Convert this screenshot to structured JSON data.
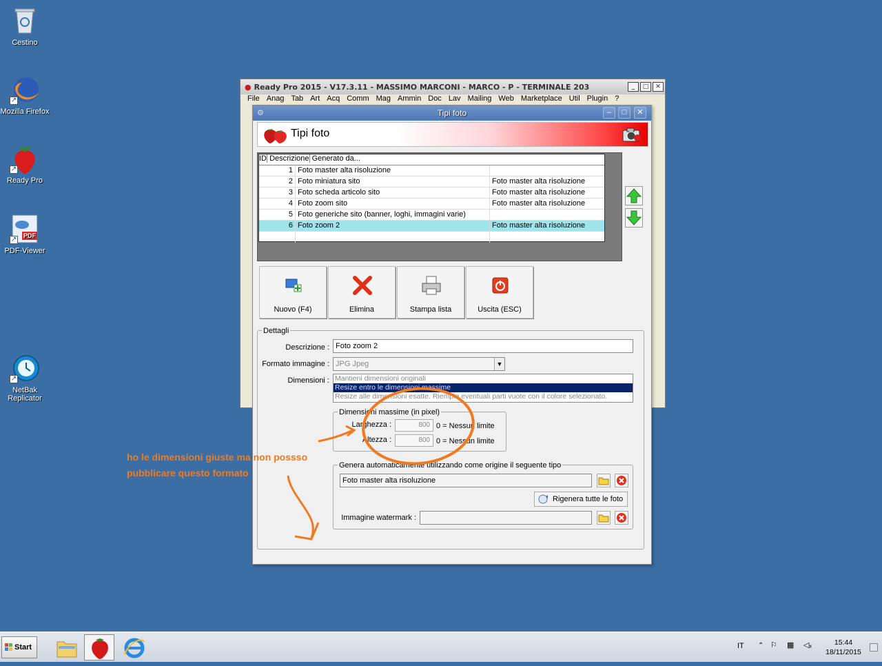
{
  "desktop": {
    "icons": [
      {
        "label": "Cestino",
        "icon": "recycle-bin-icon"
      },
      {
        "label": "Mozilla Firefox",
        "icon": "firefox-icon"
      },
      {
        "label": "Ready Pro",
        "icon": "strawberry-icon"
      },
      {
        "label": "PDF-Viewer",
        "icon": "pdf-viewer-icon"
      },
      {
        "label": "NetBak Replicator",
        "icon": "netbak-icon"
      }
    ]
  },
  "back_window": {
    "title": "Ready Pro 2015 - V17.3.11 - MASSIMO MARCONI - MARCO - P - TERMINALE 203",
    "menu": [
      "File",
      "Anag",
      "Tab",
      "Art",
      "Acq",
      "Comm",
      "Mag",
      "Ammin",
      "Doc",
      "Lav",
      "Mailing",
      "Web",
      "Marketplace",
      "Util",
      "Plugin",
      "?"
    ]
  },
  "dialog": {
    "title": "Tipi foto",
    "banner_title": "Tipi foto",
    "grid": {
      "headers": [
        "ID",
        "Descrizione",
        "Generato da..."
      ],
      "rows": [
        {
          "id": "1",
          "desc": "Foto master alta risoluzione",
          "gen": ""
        },
        {
          "id": "2",
          "desc": "Foto miniatura sito",
          "gen": "Foto master alta risoluzione"
        },
        {
          "id": "3",
          "desc": "Foto scheda articolo sito",
          "gen": "Foto master alta risoluzione"
        },
        {
          "id": "4",
          "desc": "Foto zoom sito",
          "gen": "Foto master alta risoluzione"
        },
        {
          "id": "5",
          "desc": "Foto generiche sito (banner, loghi, immagini varie)",
          "gen": ""
        },
        {
          "id": "6",
          "desc": "Foto zoom 2",
          "gen": "Foto master alta risoluzione"
        }
      ],
      "selected_row": 5
    },
    "buttons": {
      "new": "Nuovo (F4)",
      "delete": "Elimina",
      "print": "Stampa lista",
      "exit": "Uscita (ESC)"
    },
    "details": {
      "legend": "Dettagli",
      "descrizione_label": "Descrizione :",
      "descrizione_value": "Foto zoom 2",
      "formato_label": "Formato immagine :",
      "formato_value": "JPG Jpeg",
      "dimensioni_label": "Dimensioni :",
      "dimensioni_options": [
        "Mantieni dimensioni originali",
        "Resize entro le dimensioni massime",
        "Resize alle dimensioni esatte. Riempie eventuali parti vuote con il colore selezionato."
      ],
      "dimensioni_selected": 1,
      "max_dim_legend": "Dimensioni massime (in pixel)",
      "larghezza_label": "Larghezza :",
      "larghezza_value": "800",
      "altezza_label": "Altezza :",
      "altezza_value": "800",
      "nessun_limite": "0 = Nessun limite",
      "genera_legend": "Genera automaticamente utilizzando come origine il seguente tipo",
      "origine_value": "Foto master alta risoluzione",
      "rigenera_label": "Rigenera tutte le foto",
      "watermark_label": "Immagine watermark :",
      "watermark_value": ""
    }
  },
  "annotation": {
    "line1": "ho le dimensioni giuste ma non possso",
    "line2": "pubblicare questo formato",
    "color": "#f07a20"
  },
  "taskbar": {
    "start_label": "Start",
    "language": "IT",
    "time": "15:44",
    "date": "18/11/2015"
  }
}
